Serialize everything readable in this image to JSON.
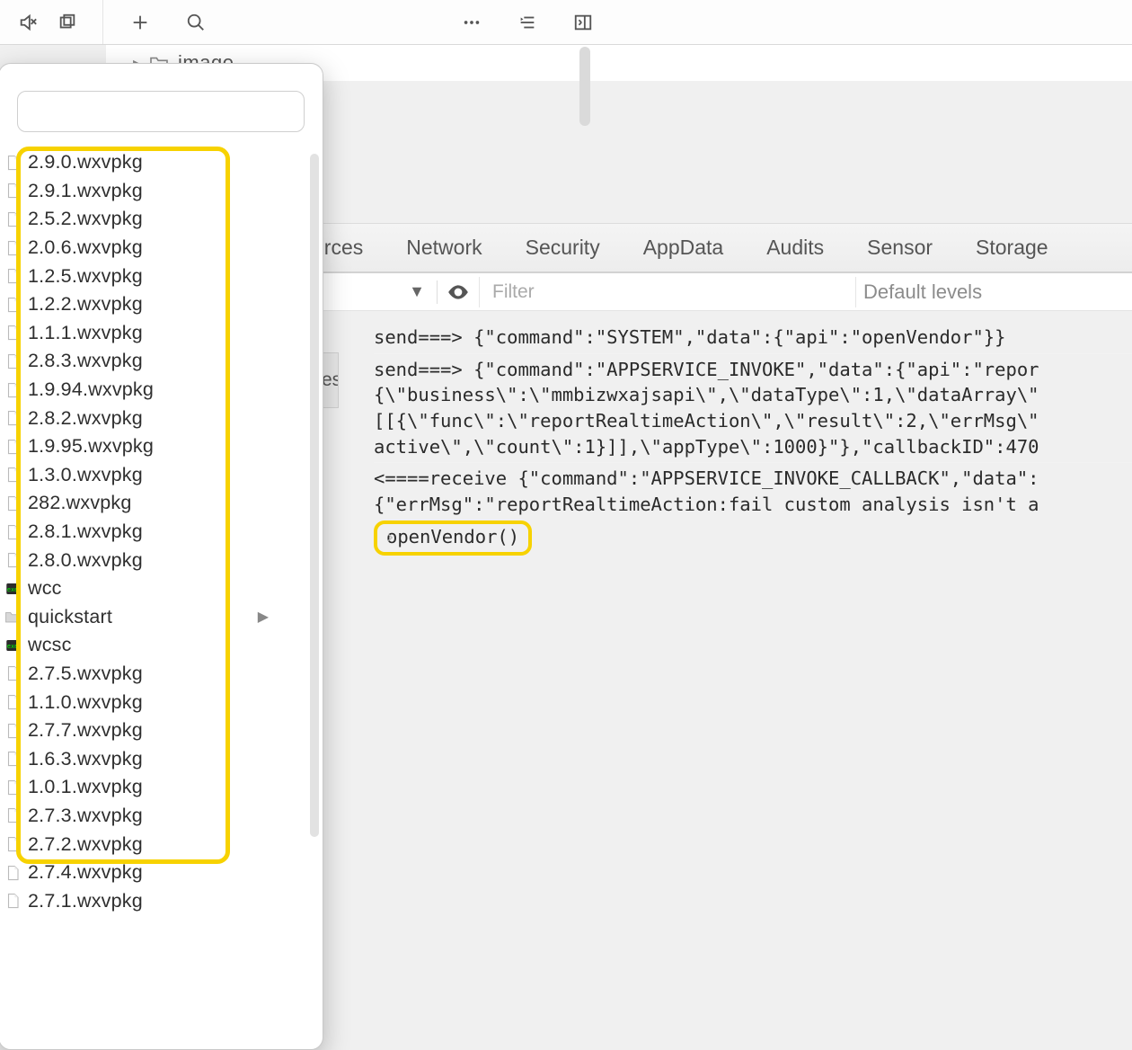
{
  "toolbar": {},
  "breadcrumb": {
    "label": "image"
  },
  "tabs": {
    "sources_partial": "urces",
    "network": "Network",
    "security": "Security",
    "appdata": "AppData",
    "audits": "Audits",
    "sensor": "Sensor",
    "storage": "Storage"
  },
  "filter": {
    "placeholder": "Filter",
    "default_levels": "Default levels"
  },
  "console": {
    "line1": "send===> {\"command\":\"SYSTEM\",\"data\":{\"api\":\"openVendor\"}}",
    "line2a": "send===> {\"command\":\"APPSERVICE_INVOKE\",\"data\":{\"api\":\"repor",
    "line2b": "{\\\"business\\\":\\\"mmbizwxajsapi\\\",\\\"dataType\\\":1,\\\"dataArray\\\"",
    "line2c": "[[{\\\"func\\\":\\\"reportRealtimeAction\\\",\\\"result\\\":2,\\\"errMsg\\\"",
    "line2d": "active\\\",\\\"count\\\":1}]],\\\"appType\\\":1000}\"},\"callbackID\":470",
    "line3a": "<====receive {\"command\":\"APPSERVICE_INVOKE_CALLBACK\",\"data\":",
    "line3b": "{\"errMsg\":\"reportRealtimeAction:fail custom analysis isn't a",
    "prompt": "openVendor()"
  },
  "sidebar_tab": {
    "label": "es"
  },
  "files": [
    {
      "name": "2.9.0.wxvpkg",
      "type": "file"
    },
    {
      "name": "2.9.1.wxvpkg",
      "type": "file"
    },
    {
      "name": "2.5.2.wxvpkg",
      "type": "file"
    },
    {
      "name": "2.0.6.wxvpkg",
      "type": "file"
    },
    {
      "name": "1.2.5.wxvpkg",
      "type": "file"
    },
    {
      "name": "1.2.2.wxvpkg",
      "type": "file"
    },
    {
      "name": "1.1.1.wxvpkg",
      "type": "file"
    },
    {
      "name": "2.8.3.wxvpkg",
      "type": "file"
    },
    {
      "name": "1.9.94.wxvpkg",
      "type": "file"
    },
    {
      "name": "2.8.2.wxvpkg",
      "type": "file"
    },
    {
      "name": "1.9.95.wxvpkg",
      "type": "file"
    },
    {
      "name": "1.3.0.wxvpkg",
      "type": "file"
    },
    {
      "name": "282.wxvpkg",
      "type": "file"
    },
    {
      "name": "2.8.1.wxvpkg",
      "type": "file"
    },
    {
      "name": "2.8.0.wxvpkg",
      "type": "file"
    },
    {
      "name": "wcc",
      "type": "exec"
    },
    {
      "name": "quickstart",
      "type": "folder"
    },
    {
      "name": "wcsc",
      "type": "exec"
    },
    {
      "name": "2.7.5.wxvpkg",
      "type": "file"
    },
    {
      "name": "1.1.0.wxvpkg",
      "type": "file"
    },
    {
      "name": "2.7.7.wxvpkg",
      "type": "file"
    },
    {
      "name": "1.6.3.wxvpkg",
      "type": "file"
    },
    {
      "name": "1.0.1.wxvpkg",
      "type": "file"
    },
    {
      "name": "2.7.3.wxvpkg",
      "type": "file"
    },
    {
      "name": "2.7.2.wxvpkg",
      "type": "file"
    },
    {
      "name": "2.7.4.wxvpkg",
      "type": "file"
    },
    {
      "name": "2.7.1.wxvpkg",
      "type": "file"
    }
  ]
}
